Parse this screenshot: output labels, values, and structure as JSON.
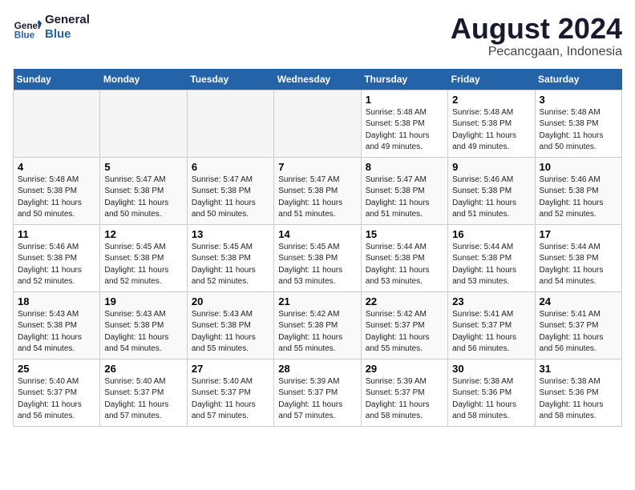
{
  "header": {
    "logo_line1": "General",
    "logo_line2": "Blue",
    "month_year": "August 2024",
    "location": "Pecancgaan, Indonesia"
  },
  "weekdays": [
    "Sunday",
    "Monday",
    "Tuesday",
    "Wednesday",
    "Thursday",
    "Friday",
    "Saturday"
  ],
  "weeks": [
    [
      {
        "day": "",
        "empty": true
      },
      {
        "day": "",
        "empty": true
      },
      {
        "day": "",
        "empty": true
      },
      {
        "day": "",
        "empty": true
      },
      {
        "day": "1",
        "sunrise": "5:48 AM",
        "sunset": "5:38 PM",
        "daylight": "11 hours and 49 minutes."
      },
      {
        "day": "2",
        "sunrise": "5:48 AM",
        "sunset": "5:38 PM",
        "daylight": "11 hours and 49 minutes."
      },
      {
        "day": "3",
        "sunrise": "5:48 AM",
        "sunset": "5:38 PM",
        "daylight": "11 hours and 50 minutes."
      }
    ],
    [
      {
        "day": "4",
        "sunrise": "5:48 AM",
        "sunset": "5:38 PM",
        "daylight": "11 hours and 50 minutes."
      },
      {
        "day": "5",
        "sunrise": "5:47 AM",
        "sunset": "5:38 PM",
        "daylight": "11 hours and 50 minutes."
      },
      {
        "day": "6",
        "sunrise": "5:47 AM",
        "sunset": "5:38 PM",
        "daylight": "11 hours and 50 minutes."
      },
      {
        "day": "7",
        "sunrise": "5:47 AM",
        "sunset": "5:38 PM",
        "daylight": "11 hours and 51 minutes."
      },
      {
        "day": "8",
        "sunrise": "5:47 AM",
        "sunset": "5:38 PM",
        "daylight": "11 hours and 51 minutes."
      },
      {
        "day": "9",
        "sunrise": "5:46 AM",
        "sunset": "5:38 PM",
        "daylight": "11 hours and 51 minutes."
      },
      {
        "day": "10",
        "sunrise": "5:46 AM",
        "sunset": "5:38 PM",
        "daylight": "11 hours and 52 minutes."
      }
    ],
    [
      {
        "day": "11",
        "sunrise": "5:46 AM",
        "sunset": "5:38 PM",
        "daylight": "11 hours and 52 minutes."
      },
      {
        "day": "12",
        "sunrise": "5:45 AM",
        "sunset": "5:38 PM",
        "daylight": "11 hours and 52 minutes."
      },
      {
        "day": "13",
        "sunrise": "5:45 AM",
        "sunset": "5:38 PM",
        "daylight": "11 hours and 52 minutes."
      },
      {
        "day": "14",
        "sunrise": "5:45 AM",
        "sunset": "5:38 PM",
        "daylight": "11 hours and 53 minutes."
      },
      {
        "day": "15",
        "sunrise": "5:44 AM",
        "sunset": "5:38 PM",
        "daylight": "11 hours and 53 minutes."
      },
      {
        "day": "16",
        "sunrise": "5:44 AM",
        "sunset": "5:38 PM",
        "daylight": "11 hours and 53 minutes."
      },
      {
        "day": "17",
        "sunrise": "5:44 AM",
        "sunset": "5:38 PM",
        "daylight": "11 hours and 54 minutes."
      }
    ],
    [
      {
        "day": "18",
        "sunrise": "5:43 AM",
        "sunset": "5:38 PM",
        "daylight": "11 hours and 54 minutes."
      },
      {
        "day": "19",
        "sunrise": "5:43 AM",
        "sunset": "5:38 PM",
        "daylight": "11 hours and 54 minutes."
      },
      {
        "day": "20",
        "sunrise": "5:43 AM",
        "sunset": "5:38 PM",
        "daylight": "11 hours and 55 minutes."
      },
      {
        "day": "21",
        "sunrise": "5:42 AM",
        "sunset": "5:38 PM",
        "daylight": "11 hours and 55 minutes."
      },
      {
        "day": "22",
        "sunrise": "5:42 AM",
        "sunset": "5:37 PM",
        "daylight": "11 hours and 55 minutes."
      },
      {
        "day": "23",
        "sunrise": "5:41 AM",
        "sunset": "5:37 PM",
        "daylight": "11 hours and 56 minutes."
      },
      {
        "day": "24",
        "sunrise": "5:41 AM",
        "sunset": "5:37 PM",
        "daylight": "11 hours and 56 minutes."
      }
    ],
    [
      {
        "day": "25",
        "sunrise": "5:40 AM",
        "sunset": "5:37 PM",
        "daylight": "11 hours and 56 minutes."
      },
      {
        "day": "26",
        "sunrise": "5:40 AM",
        "sunset": "5:37 PM",
        "daylight": "11 hours and 57 minutes."
      },
      {
        "day": "27",
        "sunrise": "5:40 AM",
        "sunset": "5:37 PM",
        "daylight": "11 hours and 57 minutes."
      },
      {
        "day": "28",
        "sunrise": "5:39 AM",
        "sunset": "5:37 PM",
        "daylight": "11 hours and 57 minutes."
      },
      {
        "day": "29",
        "sunrise": "5:39 AM",
        "sunset": "5:37 PM",
        "daylight": "11 hours and 58 minutes."
      },
      {
        "day": "30",
        "sunrise": "5:38 AM",
        "sunset": "5:36 PM",
        "daylight": "11 hours and 58 minutes."
      },
      {
        "day": "31",
        "sunrise": "5:38 AM",
        "sunset": "5:36 PM",
        "daylight": "11 hours and 58 minutes."
      }
    ]
  ]
}
